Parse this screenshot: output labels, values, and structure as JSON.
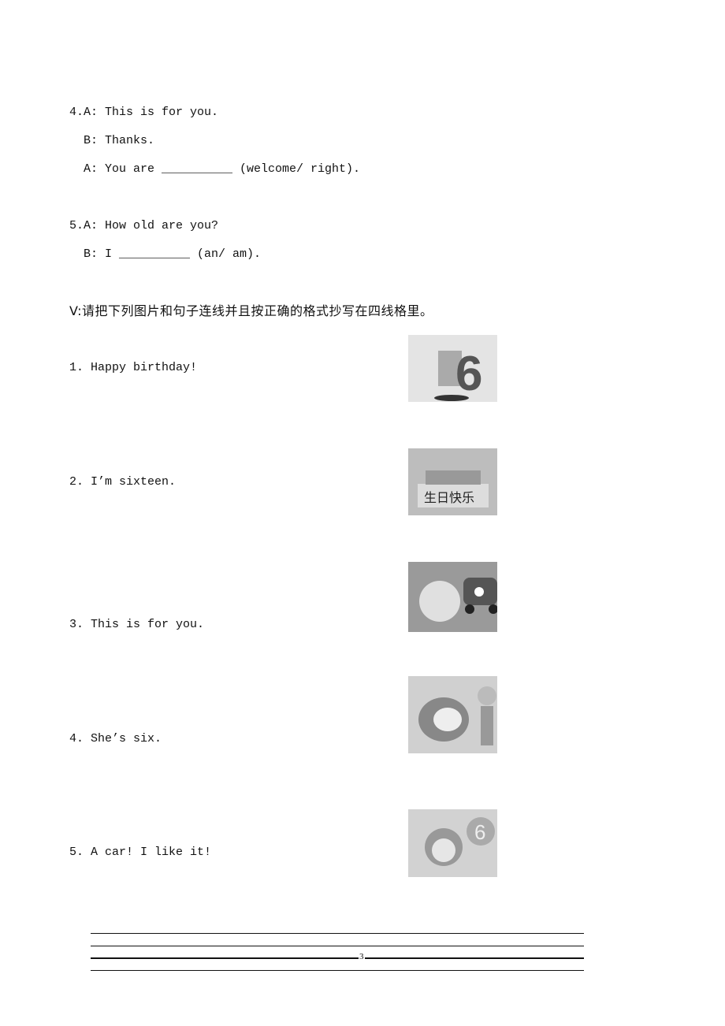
{
  "dialogs": [
    {
      "lines": [
        "4.A: This is for you.",
        "  B: Thanks.",
        "  A: You are __________ (welcome/ right)."
      ]
    },
    {
      "lines": [
        "5.A: How old are you?",
        "  B: I __________ (an/ am)."
      ]
    }
  ],
  "section_v": {
    "heading": "V:请把下列图片和句子连线并且按正确的格式抄写在四线格里。",
    "items": [
      "1. Happy birthday!",
      "2. I’m sixteen.",
      "3. This is for you.",
      "4. She’s six.",
      "5. A car! I like it!"
    ],
    "picture_text": "生日快乐"
  },
  "page_number": "3"
}
